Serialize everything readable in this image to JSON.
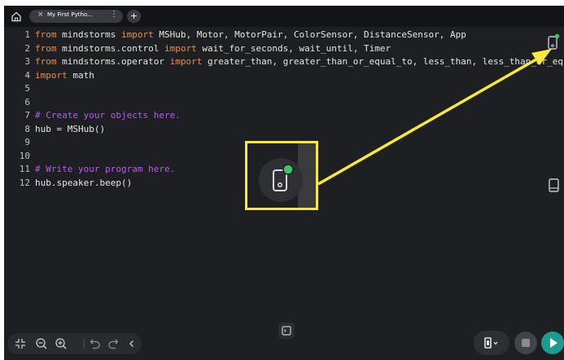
{
  "tabbar": {
    "tab_title": "My First Pytho...",
    "tab_close": "×",
    "tab_more": "⋮",
    "new_tab": "+"
  },
  "code_lines": [
    {
      "n": "1",
      "parts": [
        {
          "t": "from",
          "c": "kw"
        },
        {
          "t": " mindstorms ",
          "c": ""
        },
        {
          "t": "import",
          "c": "kw"
        },
        {
          "t": " MSHub, Motor, MotorPair, ColorSensor, DistanceSensor, App",
          "c": ""
        }
      ]
    },
    {
      "n": "2",
      "parts": [
        {
          "t": "from",
          "c": "kw"
        },
        {
          "t": " mindstorms.control ",
          "c": ""
        },
        {
          "t": "import",
          "c": "kw"
        },
        {
          "t": " wait_for_seconds, wait_until, Timer",
          "c": ""
        }
      ]
    },
    {
      "n": "3",
      "parts": [
        {
          "t": "from",
          "c": "kw"
        },
        {
          "t": " mindstorms.operator ",
          "c": ""
        },
        {
          "t": "import",
          "c": "kw"
        },
        {
          "t": " greater_than, greater_than_or_equal_to, less_than, less_than_or_equa",
          "c": ""
        }
      ]
    },
    {
      "n": "4",
      "parts": [
        {
          "t": "import",
          "c": "kw"
        },
        {
          "t": " math",
          "c": ""
        }
      ]
    },
    {
      "n": "5",
      "parts": []
    },
    {
      "n": "6",
      "parts": []
    },
    {
      "n": "7",
      "parts": [
        {
          "t": "# Create your objects here.",
          "c": "cm"
        }
      ]
    },
    {
      "n": "8",
      "parts": [
        {
          "t": "hub = MSHub()",
          "c": ""
        }
      ]
    },
    {
      "n": "9",
      "parts": []
    },
    {
      "n": "10",
      "parts": []
    },
    {
      "n": "11",
      "parts": [
        {
          "t": "# Write your program here.",
          "c": "cm"
        }
      ]
    },
    {
      "n": "12",
      "parts": [
        {
          "t": "hub.speaker.beep()",
          "c": ""
        }
      ]
    }
  ],
  "icons": {
    "home": "home-icon",
    "hub_connect": "hub-connect-icon",
    "knowledge_base": "book-icon",
    "console": "console-icon",
    "collapse": "collapse-icon",
    "zoom_out": "zoom-out-icon",
    "zoom_in": "zoom-in-icon",
    "undo": "undo-icon",
    "redo": "redo-icon",
    "chevron": "chevron-left-icon",
    "device": "device-icon",
    "stop": "stop-icon",
    "play": "play-icon"
  },
  "colors": {
    "keyword": "#e8914e",
    "comment": "#b45ee8",
    "highlight": "#f7e93a",
    "connected_dot": "#3ec46d",
    "play": "#1e9b90"
  }
}
